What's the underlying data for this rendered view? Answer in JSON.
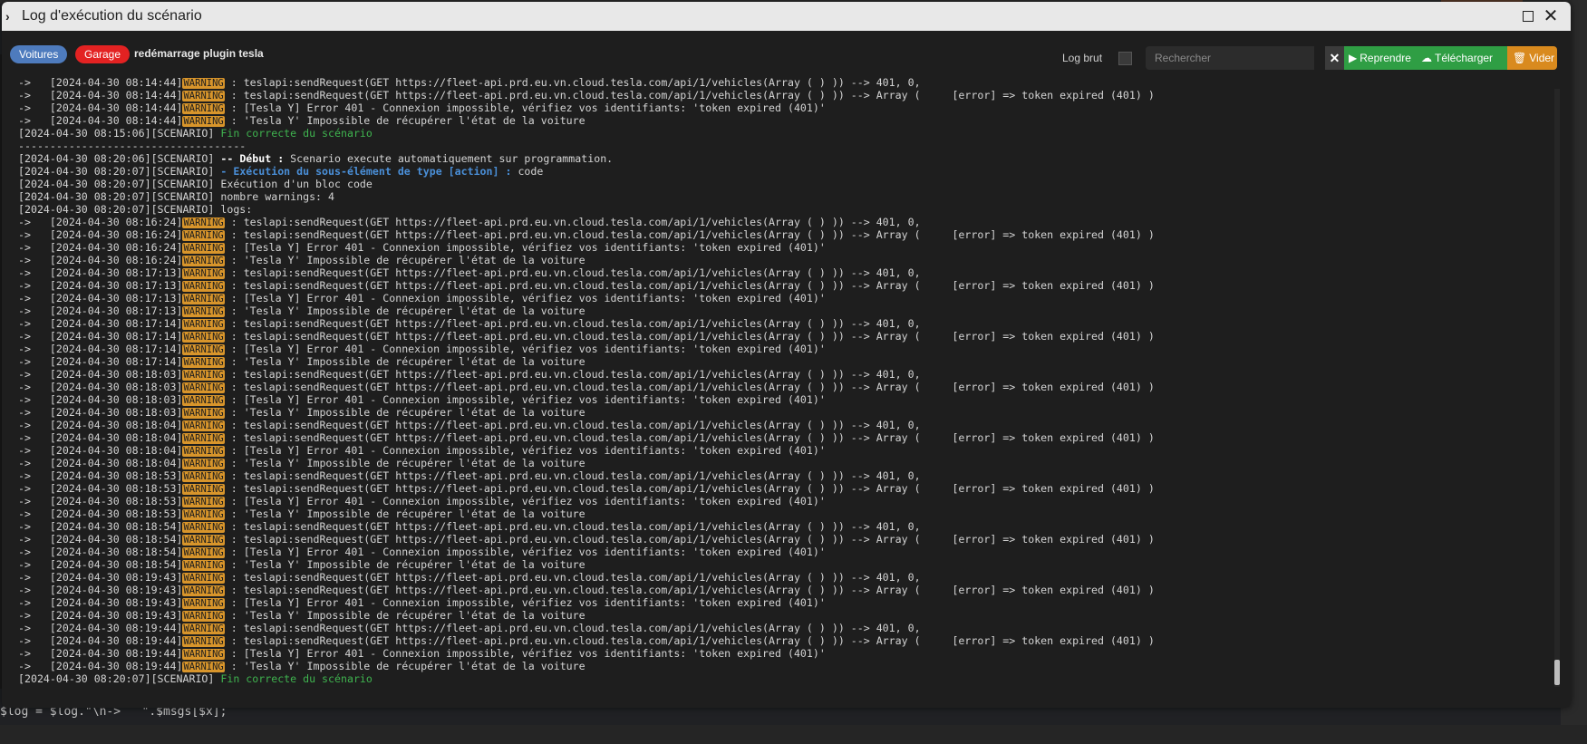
{
  "window": {
    "title": "Log d'exécution du scénario"
  },
  "toolbar": {
    "tags": [
      "Voitures",
      "Garage"
    ],
    "scenario_name": "redémarrage plugin tesla",
    "log_brut_label": "Log brut",
    "search_placeholder": "Rechercher",
    "clear_label": "✕",
    "reprendre_label": "Reprendre",
    "telecharger_label": "Télécharger",
    "vider_label": "Vider"
  },
  "background": {
    "code_line": "$log = $log.\"\\n->   \".$msgs[$x];"
  },
  "log_lines": [
    "->   [2024-04-30 08:14:44][[WARNING]] : teslapi:sendRequest(GET https://fleet-api.prd.eu.vn.cloud.tesla.com/api/1/vehicles(Array ( ) )) --> 401, 0,",
    "->   [2024-04-30 08:14:44][[WARNING]] : teslapi:sendRequest(GET https://fleet-api.prd.eu.vn.cloud.tesla.com/api/1/vehicles(Array ( ) )) --> Array (     [error] => token expired (401) )",
    "->   [2024-04-30 08:14:44][[WARNING]] : [Tesla Y] Error 401 - Connexion impossible, vérifiez vos identifiants: 'token expired (401)'",
    "->   [2024-04-30 08:14:44][[WARNING]] : 'Tesla Y' Impossible de récupérer l'état de la voiture",
    "[2024-04-30 08:15:06][SCENARIO] {{Fin correcte du scénario}}",
    "------------------------------------",
    "[2024-04-30 08:20:06][SCENARIO] <<-- Début :>> Scenario execute automatiquement sur programmation.",
    "[2024-04-30 08:20:07][SCENARIO] ((- Exécution du sous-élément de type [action] :)) code",
    "[2024-04-30 08:20:07][SCENARIO] Exécution d'un bloc code",
    "[2024-04-30 08:20:07][SCENARIO] nombre warnings: 4",
    "[2024-04-30 08:20:07][SCENARIO] logs:",
    "->   [2024-04-30 08:16:24][[WARNING]] : teslapi:sendRequest(GET https://fleet-api.prd.eu.vn.cloud.tesla.com/api/1/vehicles(Array ( ) )) --> 401, 0,",
    "->   [2024-04-30 08:16:24][[WARNING]] : teslapi:sendRequest(GET https://fleet-api.prd.eu.vn.cloud.tesla.com/api/1/vehicles(Array ( ) )) --> Array (     [error] => token expired (401) )",
    "->   [2024-04-30 08:16:24][[WARNING]] : [Tesla Y] Error 401 - Connexion impossible, vérifiez vos identifiants: 'token expired (401)'",
    "->   [2024-04-30 08:16:24][[WARNING]] : 'Tesla Y' Impossible de récupérer l'état de la voiture",
    "->   [2024-04-30 08:17:13][[WARNING]] : teslapi:sendRequest(GET https://fleet-api.prd.eu.vn.cloud.tesla.com/api/1/vehicles(Array ( ) )) --> 401, 0,",
    "->   [2024-04-30 08:17:13][[WARNING]] : teslapi:sendRequest(GET https://fleet-api.prd.eu.vn.cloud.tesla.com/api/1/vehicles(Array ( ) )) --> Array (     [error] => token expired (401) )",
    "->   [2024-04-30 08:17:13][[WARNING]] : [Tesla Y] Error 401 - Connexion impossible, vérifiez vos identifiants: 'token expired (401)'",
    "->   [2024-04-30 08:17:13][[WARNING]] : 'Tesla Y' Impossible de récupérer l'état de la voiture",
    "->   [2024-04-30 08:17:14][[WARNING]] : teslapi:sendRequest(GET https://fleet-api.prd.eu.vn.cloud.tesla.com/api/1/vehicles(Array ( ) )) --> 401, 0,",
    "->   [2024-04-30 08:17:14][[WARNING]] : teslapi:sendRequest(GET https://fleet-api.prd.eu.vn.cloud.tesla.com/api/1/vehicles(Array ( ) )) --> Array (     [error] => token expired (401) )",
    "->   [2024-04-30 08:17:14][[WARNING]] : [Tesla Y] Error 401 - Connexion impossible, vérifiez vos identifiants: 'token expired (401)'",
    "->   [2024-04-30 08:17:14][[WARNING]] : 'Tesla Y' Impossible de récupérer l'état de la voiture",
    "->   [2024-04-30 08:18:03][[WARNING]] : teslapi:sendRequest(GET https://fleet-api.prd.eu.vn.cloud.tesla.com/api/1/vehicles(Array ( ) )) --> 401, 0,",
    "->   [2024-04-30 08:18:03][[WARNING]] : teslapi:sendRequest(GET https://fleet-api.prd.eu.vn.cloud.tesla.com/api/1/vehicles(Array ( ) )) --> Array (     [error] => token expired (401) )",
    "->   [2024-04-30 08:18:03][[WARNING]] : [Tesla Y] Error 401 - Connexion impossible, vérifiez vos identifiants: 'token expired (401)'",
    "->   [2024-04-30 08:18:03][[WARNING]] : 'Tesla Y' Impossible de récupérer l'état de la voiture",
    "->   [2024-04-30 08:18:04][[WARNING]] : teslapi:sendRequest(GET https://fleet-api.prd.eu.vn.cloud.tesla.com/api/1/vehicles(Array ( ) )) --> 401, 0,",
    "->   [2024-04-30 08:18:04][[WARNING]] : teslapi:sendRequest(GET https://fleet-api.prd.eu.vn.cloud.tesla.com/api/1/vehicles(Array ( ) )) --> Array (     [error] => token expired (401) )",
    "->   [2024-04-30 08:18:04][[WARNING]] : [Tesla Y] Error 401 - Connexion impossible, vérifiez vos identifiants: 'token expired (401)'",
    "->   [2024-04-30 08:18:04][[WARNING]] : 'Tesla Y' Impossible de récupérer l'état de la voiture",
    "->   [2024-04-30 08:18:53][[WARNING]] : teslapi:sendRequest(GET https://fleet-api.prd.eu.vn.cloud.tesla.com/api/1/vehicles(Array ( ) )) --> 401, 0,",
    "->   [2024-04-30 08:18:53][[WARNING]] : teslapi:sendRequest(GET https://fleet-api.prd.eu.vn.cloud.tesla.com/api/1/vehicles(Array ( ) )) --> Array (     [error] => token expired (401) )",
    "->   [2024-04-30 08:18:53][[WARNING]] : [Tesla Y] Error 401 - Connexion impossible, vérifiez vos identifiants: 'token expired (401)'",
    "->   [2024-04-30 08:18:53][[WARNING]] : 'Tesla Y' Impossible de récupérer l'état de la voiture",
    "->   [2024-04-30 08:18:54][[WARNING]] : teslapi:sendRequest(GET https://fleet-api.prd.eu.vn.cloud.tesla.com/api/1/vehicles(Array ( ) )) --> 401, 0,",
    "->   [2024-04-30 08:18:54][[WARNING]] : teslapi:sendRequest(GET https://fleet-api.prd.eu.vn.cloud.tesla.com/api/1/vehicles(Array ( ) )) --> Array (     [error] => token expired (401) )",
    "->   [2024-04-30 08:18:54][[WARNING]] : [Tesla Y] Error 401 - Connexion impossible, vérifiez vos identifiants: 'token expired (401)'",
    "->   [2024-04-30 08:18:54][[WARNING]] : 'Tesla Y' Impossible de récupérer l'état de la voiture",
    "->   [2024-04-30 08:19:43][[WARNING]] : teslapi:sendRequest(GET https://fleet-api.prd.eu.vn.cloud.tesla.com/api/1/vehicles(Array ( ) )) --> 401, 0,",
    "->   [2024-04-30 08:19:43][[WARNING]] : teslapi:sendRequest(GET https://fleet-api.prd.eu.vn.cloud.tesla.com/api/1/vehicles(Array ( ) )) --> Array (     [error] => token expired (401) )",
    "->   [2024-04-30 08:19:43][[WARNING]] : [Tesla Y] Error 401 - Connexion impossible, vérifiez vos identifiants: 'token expired (401)'",
    "->   [2024-04-30 08:19:43][[WARNING]] : 'Tesla Y' Impossible de récupérer l'état de la voiture",
    "->   [2024-04-30 08:19:44][[WARNING]] : teslapi:sendRequest(GET https://fleet-api.prd.eu.vn.cloud.tesla.com/api/1/vehicles(Array ( ) )) --> 401, 0,",
    "->   [2024-04-30 08:19:44][[WARNING]] : teslapi:sendRequest(GET https://fleet-api.prd.eu.vn.cloud.tesla.com/api/1/vehicles(Array ( ) )) --> Array (     [error] => token expired (401) )",
    "->   [2024-04-30 08:19:44][[WARNING]] : [Tesla Y] Error 401 - Connexion impossible, vérifiez vos identifiants: 'token expired (401)'",
    "->   [2024-04-30 08:19:44][[WARNING]] : 'Tesla Y' Impossible de récupérer l'état de la voiture",
    "[2024-04-30 08:20:07][SCENARIO] {{Fin correcte du scénario}}"
  ],
  "colors": {
    "warning_badge": "#d8952b",
    "success_text": "#3fb34f",
    "action_text": "#4a8fd8",
    "tag_voitures": "#4e7bbd",
    "tag_garage": "#e32222",
    "btn_green": "#2f9e44",
    "btn_orange": "#d98a1e"
  },
  "icons": {
    "title": "chevron-right-icon",
    "maximize": "maximize-icon",
    "close": "close-icon",
    "reprendre": "play-icon",
    "telecharger": "cloud-download-icon",
    "vider": "trash-icon"
  }
}
